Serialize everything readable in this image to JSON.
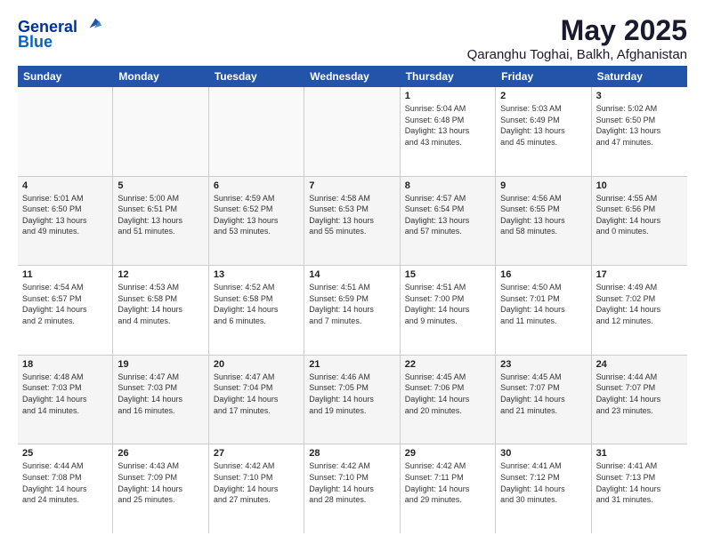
{
  "header": {
    "logo_line1": "General",
    "logo_line2": "Blue",
    "title": "May 2025",
    "subtitle": "Qaranghu Toghai, Balkh, Afghanistan"
  },
  "weekdays": [
    "Sunday",
    "Monday",
    "Tuesday",
    "Wednesday",
    "Thursday",
    "Friday",
    "Saturday"
  ],
  "rows": [
    [
      {
        "day": "",
        "info": ""
      },
      {
        "day": "",
        "info": ""
      },
      {
        "day": "",
        "info": ""
      },
      {
        "day": "",
        "info": ""
      },
      {
        "day": "1",
        "info": "Sunrise: 5:04 AM\nSunset: 6:48 PM\nDaylight: 13 hours\nand 43 minutes."
      },
      {
        "day": "2",
        "info": "Sunrise: 5:03 AM\nSunset: 6:49 PM\nDaylight: 13 hours\nand 45 minutes."
      },
      {
        "day": "3",
        "info": "Sunrise: 5:02 AM\nSunset: 6:50 PM\nDaylight: 13 hours\nand 47 minutes."
      }
    ],
    [
      {
        "day": "4",
        "info": "Sunrise: 5:01 AM\nSunset: 6:50 PM\nDaylight: 13 hours\nand 49 minutes."
      },
      {
        "day": "5",
        "info": "Sunrise: 5:00 AM\nSunset: 6:51 PM\nDaylight: 13 hours\nand 51 minutes."
      },
      {
        "day": "6",
        "info": "Sunrise: 4:59 AM\nSunset: 6:52 PM\nDaylight: 13 hours\nand 53 minutes."
      },
      {
        "day": "7",
        "info": "Sunrise: 4:58 AM\nSunset: 6:53 PM\nDaylight: 13 hours\nand 55 minutes."
      },
      {
        "day": "8",
        "info": "Sunrise: 4:57 AM\nSunset: 6:54 PM\nDaylight: 13 hours\nand 57 minutes."
      },
      {
        "day": "9",
        "info": "Sunrise: 4:56 AM\nSunset: 6:55 PM\nDaylight: 13 hours\nand 58 minutes."
      },
      {
        "day": "10",
        "info": "Sunrise: 4:55 AM\nSunset: 6:56 PM\nDaylight: 14 hours\nand 0 minutes."
      }
    ],
    [
      {
        "day": "11",
        "info": "Sunrise: 4:54 AM\nSunset: 6:57 PM\nDaylight: 14 hours\nand 2 minutes."
      },
      {
        "day": "12",
        "info": "Sunrise: 4:53 AM\nSunset: 6:58 PM\nDaylight: 14 hours\nand 4 minutes."
      },
      {
        "day": "13",
        "info": "Sunrise: 4:52 AM\nSunset: 6:58 PM\nDaylight: 14 hours\nand 6 minutes."
      },
      {
        "day": "14",
        "info": "Sunrise: 4:51 AM\nSunset: 6:59 PM\nDaylight: 14 hours\nand 7 minutes."
      },
      {
        "day": "15",
        "info": "Sunrise: 4:51 AM\nSunset: 7:00 PM\nDaylight: 14 hours\nand 9 minutes."
      },
      {
        "day": "16",
        "info": "Sunrise: 4:50 AM\nSunset: 7:01 PM\nDaylight: 14 hours\nand 11 minutes."
      },
      {
        "day": "17",
        "info": "Sunrise: 4:49 AM\nSunset: 7:02 PM\nDaylight: 14 hours\nand 12 minutes."
      }
    ],
    [
      {
        "day": "18",
        "info": "Sunrise: 4:48 AM\nSunset: 7:03 PM\nDaylight: 14 hours\nand 14 minutes."
      },
      {
        "day": "19",
        "info": "Sunrise: 4:47 AM\nSunset: 7:03 PM\nDaylight: 14 hours\nand 16 minutes."
      },
      {
        "day": "20",
        "info": "Sunrise: 4:47 AM\nSunset: 7:04 PM\nDaylight: 14 hours\nand 17 minutes."
      },
      {
        "day": "21",
        "info": "Sunrise: 4:46 AM\nSunset: 7:05 PM\nDaylight: 14 hours\nand 19 minutes."
      },
      {
        "day": "22",
        "info": "Sunrise: 4:45 AM\nSunset: 7:06 PM\nDaylight: 14 hours\nand 20 minutes."
      },
      {
        "day": "23",
        "info": "Sunrise: 4:45 AM\nSunset: 7:07 PM\nDaylight: 14 hours\nand 21 minutes."
      },
      {
        "day": "24",
        "info": "Sunrise: 4:44 AM\nSunset: 7:07 PM\nDaylight: 14 hours\nand 23 minutes."
      }
    ],
    [
      {
        "day": "25",
        "info": "Sunrise: 4:44 AM\nSunset: 7:08 PM\nDaylight: 14 hours\nand 24 minutes."
      },
      {
        "day": "26",
        "info": "Sunrise: 4:43 AM\nSunset: 7:09 PM\nDaylight: 14 hours\nand 25 minutes."
      },
      {
        "day": "27",
        "info": "Sunrise: 4:42 AM\nSunset: 7:10 PM\nDaylight: 14 hours\nand 27 minutes."
      },
      {
        "day": "28",
        "info": "Sunrise: 4:42 AM\nSunset: 7:10 PM\nDaylight: 14 hours\nand 28 minutes."
      },
      {
        "day": "29",
        "info": "Sunrise: 4:42 AM\nSunset: 7:11 PM\nDaylight: 14 hours\nand 29 minutes."
      },
      {
        "day": "30",
        "info": "Sunrise: 4:41 AM\nSunset: 7:12 PM\nDaylight: 14 hours\nand 30 minutes."
      },
      {
        "day": "31",
        "info": "Sunrise: 4:41 AM\nSunset: 7:13 PM\nDaylight: 14 hours\nand 31 minutes."
      }
    ]
  ]
}
